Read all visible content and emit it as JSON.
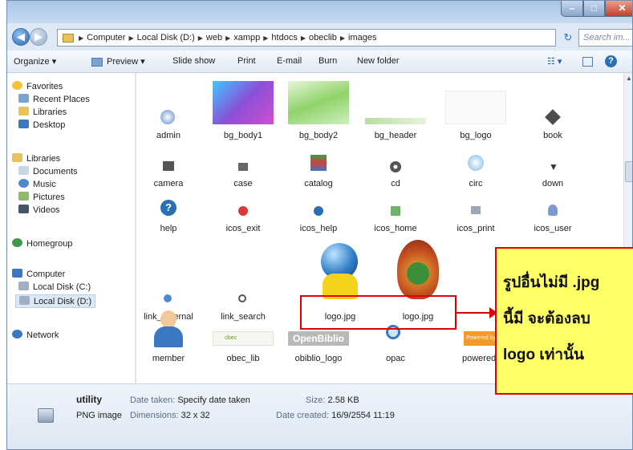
{
  "address": {
    "crumbs": [
      "Computer",
      "Local Disk (D:)",
      "web",
      "xampp",
      "htdocs",
      "obeclib",
      "images"
    ],
    "search_placeholder": "Search im..."
  },
  "toolbar": {
    "organize": "Organize ▾",
    "preview": "Preview ▾",
    "slideshow": "Slide show",
    "print": "Print",
    "email": "E-mail",
    "burn": "Burn",
    "new_folder": "New folder"
  },
  "sidebar": {
    "favorites": "Favorites",
    "recent": "Recent Places",
    "libraries_fav": "Libraries",
    "desktop": "Desktop",
    "libraries": "Libraries",
    "documents": "Documents",
    "music": "Music",
    "pictures": "Pictures",
    "videos": "Videos",
    "homegroup": "Homegroup",
    "computer": "Computer",
    "disk_c": "Local Disk (C:)",
    "disk_d": "Local Disk (D:)",
    "network": "Network"
  },
  "files": [
    "admin",
    "bg_body1",
    "bg_body2",
    "bg_header",
    "bg_logo",
    "book",
    "camera",
    "case",
    "catalog",
    "cd",
    "circ",
    "down",
    "help",
    "icos_exit",
    "icos_help",
    "icos_home",
    "icos_print",
    "icos_user",
    "link_external",
    "link_search",
    "logo.jpg",
    "logo.jpg",
    "member",
    "obec_lib",
    "obiblio_logo",
    "opac",
    "powered_by_openbiblio"
  ],
  "thumb_text": {
    "openbiblio": "OpenBiblio",
    "obec": "obec",
    "powered": "Powered by"
  },
  "details": {
    "filename": "utility",
    "filetype": "PNG image",
    "date_taken_label": "Date taken:",
    "date_taken_value": "Specify date taken",
    "dimensions_label": "Dimensions:",
    "dimensions_value": "32 x 32",
    "size_label": "Size:",
    "size_value": "2.58 KB",
    "created_label": "Date created:",
    "created_value": "16/9/2554 11:19"
  },
  "callout": {
    "line1": "รูปอื่นไม่มี .jpg",
    "line2": "นี้มี จะต้องลบ",
    "line3": "logo เท่านั้น"
  },
  "colors": {
    "accent": "#e00000",
    "callout_bg": "#ffff66"
  }
}
